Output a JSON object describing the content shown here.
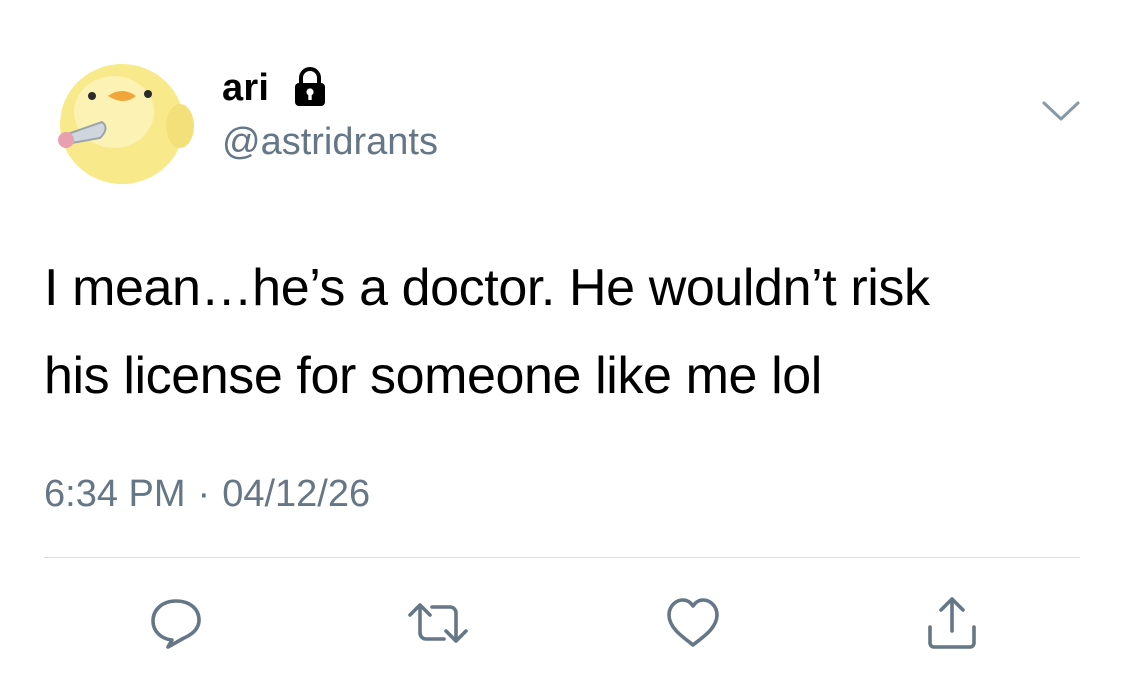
{
  "author": {
    "display_name": "ari",
    "handle": "@astridrants",
    "avatar": "yellow-chick-holding-knife",
    "protected_icon": "lock-icon"
  },
  "menu_icon": "chevron-down-icon",
  "tweet": {
    "lines": [
      "I mean…he’s a doctor. He wouldn’t risk",
      "his license for someone like me lol"
    ]
  },
  "meta": {
    "time": "6:34 PM",
    "separator": "·",
    "date": "04/12/26"
  },
  "actions": [
    {
      "name": "reply",
      "icon": "comment-icon"
    },
    {
      "name": "retweet",
      "icon": "retweet-icon"
    },
    {
      "name": "like",
      "icon": "heart-icon"
    },
    {
      "name": "share",
      "icon": "share-icon"
    }
  ],
  "colors": {
    "text": "#000000",
    "secondary": "#657786",
    "icon": "#657786",
    "divider": "#d8dee3"
  }
}
